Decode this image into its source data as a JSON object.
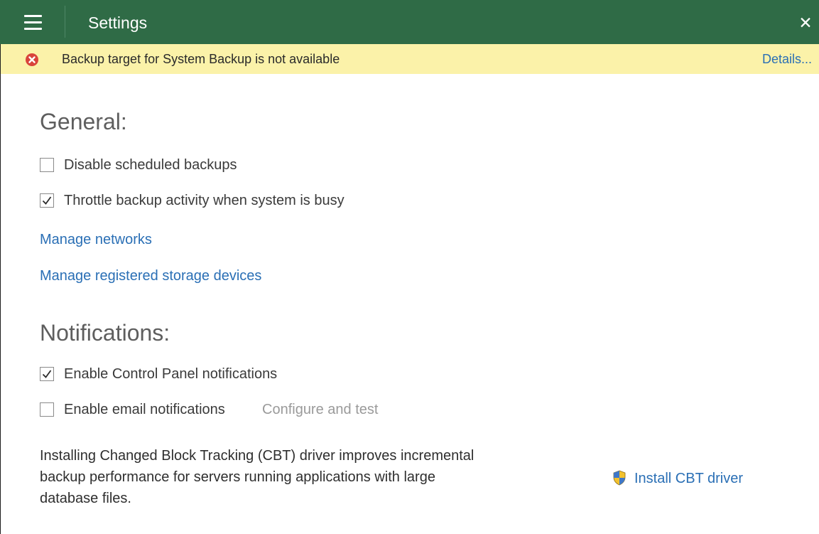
{
  "window": {
    "title": "Settings",
    "menu_icon": "hamburger-menu-icon",
    "close_glyph": "✕",
    "header_color": "#2f6b46"
  },
  "alert": {
    "icon": "error-circle-icon",
    "message": "Backup target for System Backup is not available",
    "details_link": "Details...",
    "background": "#fbf2a9"
  },
  "general": {
    "heading": "General:",
    "options": [
      {
        "label": "Disable scheduled backups",
        "checked": false
      },
      {
        "label": "Throttle backup activity when system is busy",
        "checked": true
      }
    ],
    "links": [
      "Manage networks",
      "Manage registered storage devices"
    ]
  },
  "notifications": {
    "heading": "Notifications:",
    "options": [
      {
        "label": "Enable Control Panel notifications",
        "checked": true
      },
      {
        "label": "Enable email notifications",
        "checked": false
      }
    ],
    "configure_link": "Configure and test"
  },
  "cbt": {
    "line1": "Installing Changed Block Tracking (CBT) driver improves incremental",
    "line2": "backup performance for servers running applications with large",
    "line3": "database files.",
    "install_link": "Install CBT driver",
    "install_icon": "uac-shield-icon"
  },
  "colors": {
    "link": "#2a6fb5",
    "alert_icon": "#d9443b"
  }
}
